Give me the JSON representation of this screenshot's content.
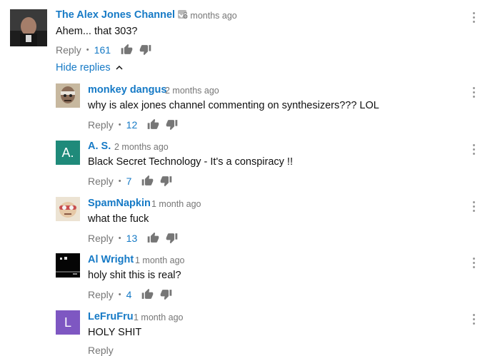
{
  "thread": {
    "author": "The Alex Jones Channel",
    "time": "6 months ago",
    "text": "Ahem... that 303?",
    "reply_label": "Reply",
    "likes": "161",
    "hide_replies_label": "Hide replies",
    "verified_icon": "verified-check-icon"
  },
  "replies": [
    {
      "author": "monkey dangus",
      "time": "2 months ago",
      "text": "why is alex jones channel commenting on synthesizers??? LOL",
      "reply_label": "Reply",
      "likes": "12",
      "avatar_type": "photo",
      "avatar_color": "#8b7a63"
    },
    {
      "author": "A. S.",
      "time": "2 months ago",
      "text": "Black Secret Technology - It's a conspiracy !!",
      "reply_label": "Reply",
      "likes": "7",
      "avatar_type": "letter",
      "avatar_letter": "A.",
      "avatar_color": "#1f8a7a"
    },
    {
      "author": "SpamNapkin",
      "time": "1 month ago",
      "text": "what the fuck",
      "reply_label": "Reply",
      "likes": "13",
      "avatar_type": "photo",
      "avatar_color": "#e7d9c4"
    },
    {
      "author": "Al Wright",
      "time": "1 month ago",
      "text": "holy shit this is real?",
      "reply_label": "Reply",
      "likes": "4",
      "avatar_type": "photo",
      "avatar_color": "#0a0a0a"
    },
    {
      "author": "LeFruFru",
      "time": "1 month ago",
      "text": "HOLY SHIT",
      "reply_label": "Reply",
      "likes": "",
      "avatar_type": "letter",
      "avatar_letter": "L",
      "avatar_color": "#7e57c2"
    }
  ],
  "colors": {
    "link_blue": "#167ac6",
    "muted_gray": "#767676"
  }
}
